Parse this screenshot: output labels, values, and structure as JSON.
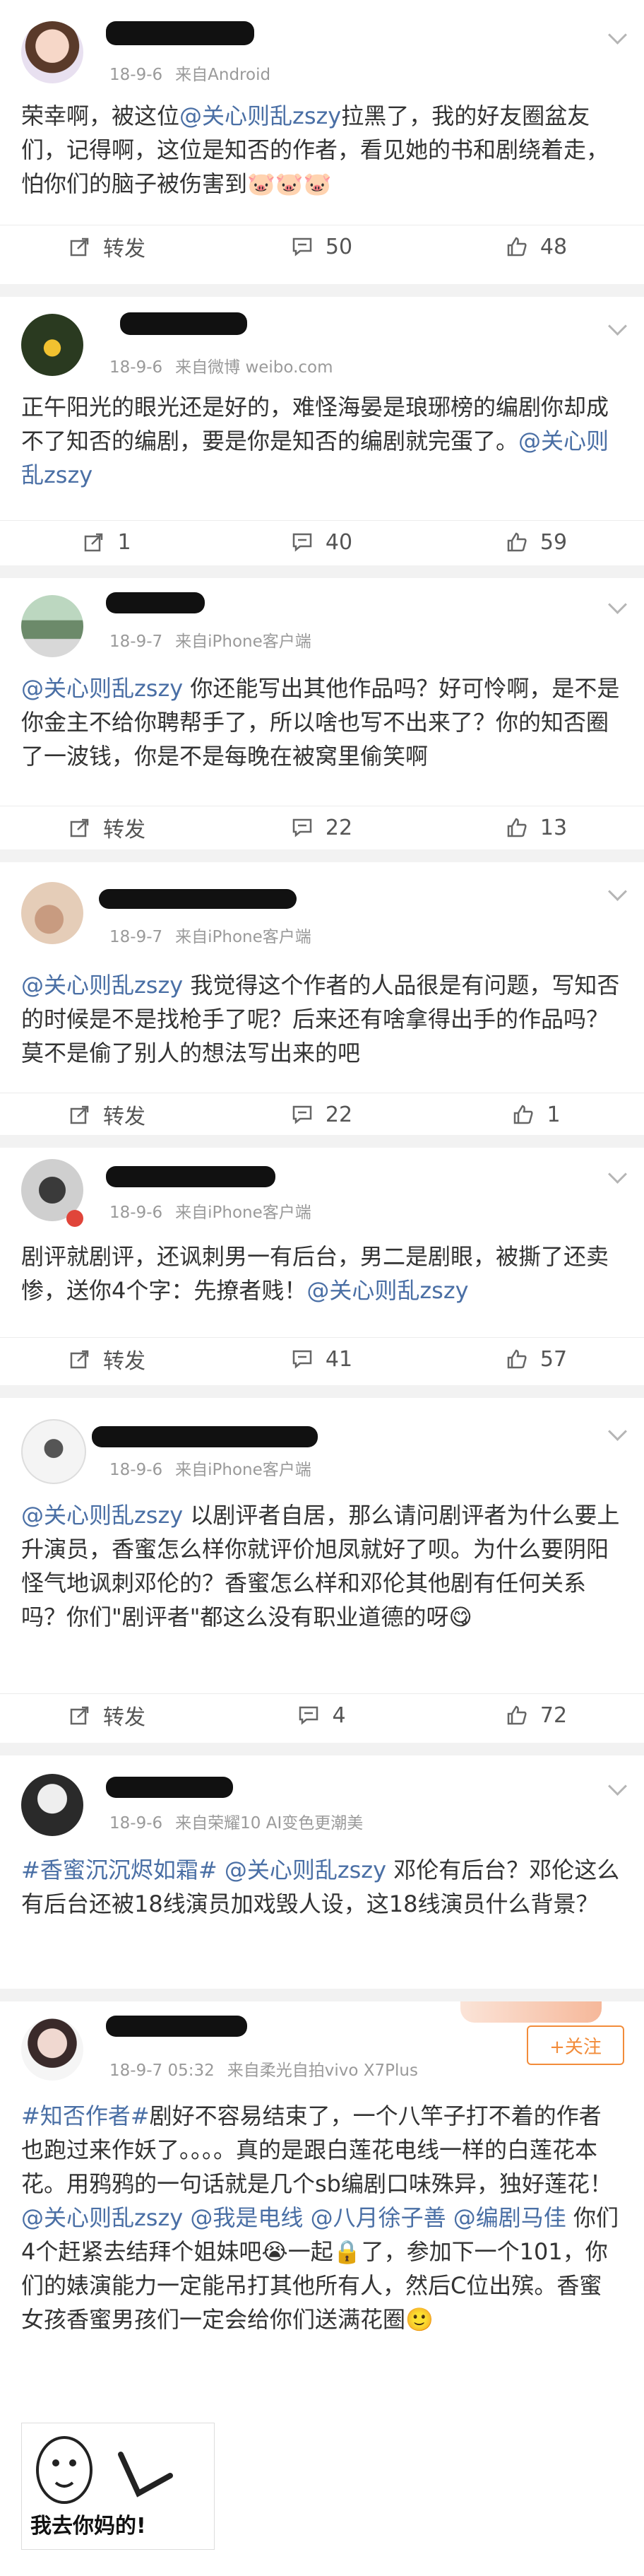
{
  "posts": [
    {
      "date": "18-9-6",
      "source": "来自Android",
      "text": [
        {
          "t": "荣幸啊，被这位"
        },
        {
          "t": "@关心则乱zszy",
          "at": true
        },
        {
          "t": "拉黑了，我的好友圈盆友们，记得啊，这位是知否的作者，看见她的书和剧绕着走，怕你们的脑子被伤害到"
        },
        {
          "t": "🐷🐷🐷",
          "emoji": true
        }
      ],
      "actions": {
        "repost": "转发",
        "comment": "50",
        "like": "48"
      }
    },
    {
      "date": "18-9-6",
      "source": "来自微博 weibo.com",
      "text": [
        {
          "t": "正午阳光的眼光还是好的，难怪海晏是琅琊榜的编剧你却成不了知否的编剧，要是你是知否的编剧就完蛋了。"
        },
        {
          "t": "@关心则乱zszy",
          "at": true
        }
      ],
      "actions": {
        "repost": "1",
        "comment": "40",
        "like": "59"
      }
    },
    {
      "date": "18-9-7",
      "source": "来自iPhone客户端",
      "text": [
        {
          "t": "@关心则乱zszy",
          "at": true
        },
        {
          "t": " 你还能写出其他作品吗？好可怜啊，是不是你金主不给你聘帮手了，所以啥也写不出来了？你的知否圈了一波钱，你是不是每晚在被窝里偷笑啊"
        }
      ],
      "actions": {
        "repost": "转发",
        "comment": "22",
        "like": "13"
      }
    },
    {
      "date": "18-9-7",
      "source": "来自iPhone客户端",
      "text": [
        {
          "t": "@关心则乱zszy",
          "at": true
        },
        {
          "t": " 我觉得这个作者的人品很是有问题，写知否的时候是不是找枪手了呢？后来还有啥拿得出手的作品吗？莫不是偷了别人的想法写出来的吧"
        }
      ],
      "actions": {
        "repost": "转发",
        "comment": "22",
        "like": "1"
      }
    },
    {
      "date": "18-9-6",
      "source": "来自iPhone客户端",
      "text": [
        {
          "t": "剧评就剧评，还讽刺男一有后台，男二是剧眼，被撕了还卖惨，送你4个字：先撩者贱！"
        },
        {
          "t": "@关心则乱zszy",
          "at": true
        }
      ],
      "actions": {
        "repost": "转发",
        "comment": "41",
        "like": "57"
      }
    },
    {
      "date": "18-9-6",
      "source": "来自iPhone客户端",
      "text": [
        {
          "t": "@关心则乱zszy",
          "at": true
        },
        {
          "t": " 以剧评者自居，那么请问剧评者为什么要上升演员，香蜜怎么样你就评价旭凤就好了呗。为什么要阴阳怪气地讽刺邓伦的？香蜜怎么样和邓伦其他剧有任何关系吗？你们\"剧评者\"都这么没有职业道德的呀"
        },
        {
          "t": "😋",
          "emoji": true
        }
      ],
      "actions": {
        "repost": "转发",
        "comment": "4",
        "like": "72"
      }
    },
    {
      "date": "18-9-6",
      "source": "来自荣耀10 AI变色更潮美",
      "text": [
        {
          "t": "#香蜜沉沉烬如霜#",
          "at": true
        },
        {
          "t": " "
        },
        {
          "t": "@关心则乱zszy",
          "at": true
        },
        {
          "t": " 邓伦有后台？邓伦这么有后台还被18线演员加戏毁人设，这18线演员什么背景？"
        }
      ]
    },
    {
      "date": "18-9-7 05:32",
      "source": "来自柔光自拍vivo X7Plus",
      "follow": "+关注",
      "text": [
        {
          "t": "#知否作者#",
          "at": true
        },
        {
          "t": "剧好不容易结束了，一个八竿子打不着的作者也跑过来作妖了。。。。真的是跟白莲花电线一样的白莲花本花。用鸦鸦的一句话就是几个sb编剧口味殊异，独好莲花！"
        },
        {
          "t": "@关心则乱zszy",
          "at": true
        },
        {
          "t": " "
        },
        {
          "t": "@我是电线",
          "at": true
        },
        {
          "t": " "
        },
        {
          "t": "@八月徐子善",
          "at": true
        },
        {
          "t": " "
        },
        {
          "t": "@编剧马佳",
          "at": true
        },
        {
          "t": " 你们4个赶紧去结拜个姐妹吧"
        },
        {
          "t": "😭",
          "emoji": true
        },
        {
          "t": "一起🔒了，参加下一个101，你们的婊演能力一定能吊打其他所有人，然后C位出殡。香蜜女孩香蜜男孩们一定会给你们送满花圈"
        },
        {
          "t": "🙂",
          "emoji": true
        }
      ],
      "sticker_caption": "我去你妈的!"
    }
  ],
  "colors": {
    "link": "#4a6fa5",
    "follow": "#f28c3a"
  }
}
